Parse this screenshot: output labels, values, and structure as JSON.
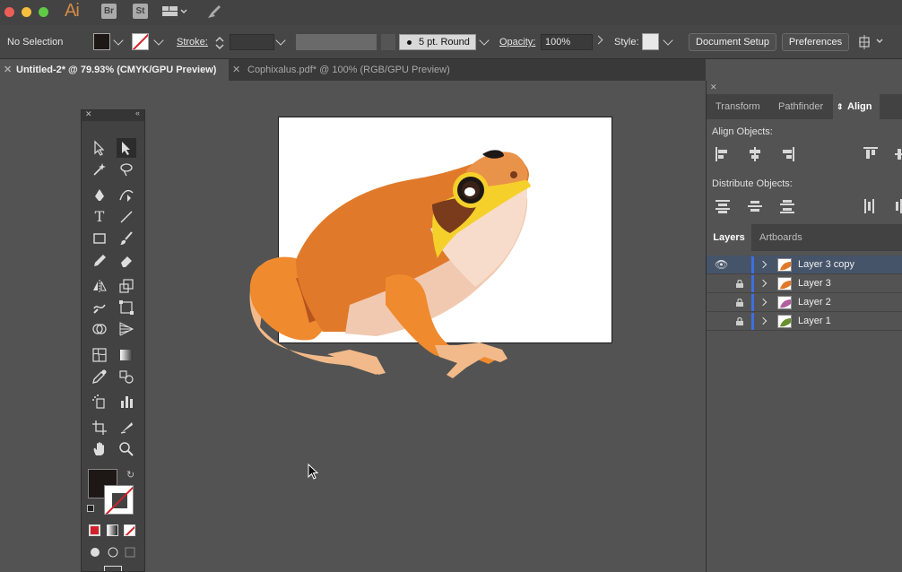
{
  "app": {
    "logo": "Ai",
    "bridge": "Br",
    "stock": "St"
  },
  "control_bar": {
    "selection": "No Selection",
    "stroke_label": "Stroke:",
    "brush": "5 pt. Round",
    "opacity_label": "Opacity:",
    "opacity_value": "100%",
    "style_label": "Style:",
    "document_setup": "Document Setup",
    "preferences": "Preferences"
  },
  "tabs": [
    {
      "label": "Untitled-2* @ 79.93% (CMYK/GPU Preview)",
      "active": true
    },
    {
      "label": "Cophixalus.pdf* @ 100% (RGB/GPU Preview)",
      "active": false
    }
  ],
  "panel_tabs": [
    "Transform",
    "Pathfinder",
    "Align"
  ],
  "align": {
    "align_objects": "Align Objects:",
    "distribute_objects": "Distribute Objects:"
  },
  "layers_tabs": [
    "Layers",
    "Artboards"
  ],
  "layers": [
    {
      "name": "Layer 3 copy",
      "visible": true,
      "locked": false
    },
    {
      "name": "Layer 3",
      "visible": false,
      "locked": true
    },
    {
      "name": "Layer 2",
      "visible": false,
      "locked": true
    },
    {
      "name": "Layer 1",
      "visible": false,
      "locked": true
    }
  ],
  "colors": {
    "fill": "#1d1716",
    "frog_orange": "#e07a2a",
    "frog_light": "#f2ba8a",
    "frog_dark": "#b5541e",
    "frog_yellow": "#f5d02a"
  }
}
